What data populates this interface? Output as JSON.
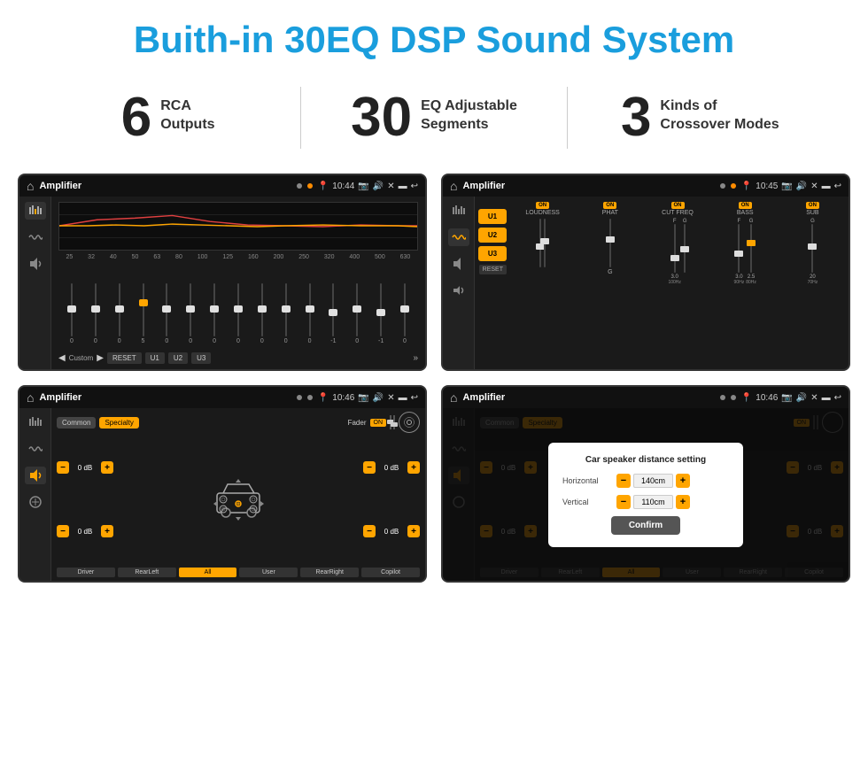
{
  "header": {
    "title": "Buith-in 30EQ DSP Sound System"
  },
  "stats": [
    {
      "number": "6",
      "label_line1": "RCA",
      "label_line2": "Outputs"
    },
    {
      "number": "30",
      "label_line1": "EQ Adjustable",
      "label_line2": "Segments"
    },
    {
      "number": "3",
      "label_line1": "Kinds of",
      "label_line2": "Crossover Modes"
    }
  ],
  "screens": {
    "eq": {
      "title": "Amplifier",
      "time": "10:44",
      "freqs": [
        "25",
        "32",
        "40",
        "50",
        "63",
        "80",
        "100",
        "125",
        "160",
        "200",
        "250",
        "320",
        "400",
        "500",
        "630"
      ],
      "values": [
        "0",
        "0",
        "0",
        "5",
        "0",
        "0",
        "0",
        "0",
        "0",
        "0",
        "0",
        "-1",
        "0",
        "-1"
      ],
      "bottom_btns": [
        "Custom",
        "RESET",
        "U1",
        "U2",
        "U3"
      ]
    },
    "crossover": {
      "title": "Amplifier",
      "time": "10:45",
      "presets": [
        "U1",
        "U2",
        "U3"
      ],
      "controls": [
        "LOUDNESS",
        "PHAT",
        "CUT FREQ",
        "BASS",
        "SUB"
      ],
      "reset": "RESET"
    },
    "fader": {
      "title": "Amplifier",
      "time": "10:46",
      "tabs": [
        "Common",
        "Specialty"
      ],
      "fader_label": "Fader",
      "db_values": [
        "0 dB",
        "0 dB",
        "0 dB",
        "0 dB"
      ],
      "bottom_btns": [
        "Driver",
        "RearLeft",
        "All",
        "User",
        "RearRight",
        "Copilot"
      ]
    },
    "distance": {
      "title": "Amplifier",
      "time": "10:46",
      "tabs": [
        "Common",
        "Specialty"
      ],
      "dialog": {
        "title": "Car speaker distance setting",
        "horizontal_label": "Horizontal",
        "horizontal_value": "140cm",
        "vertical_label": "Vertical",
        "vertical_value": "110cm",
        "confirm_btn": "Confirm"
      },
      "db_right_top": "0 dB",
      "db_right_bottom": "0 dB",
      "bottom_btns": [
        "Driver",
        "RearLeft",
        "All",
        "User",
        "RearRight",
        "Copilot"
      ]
    }
  }
}
